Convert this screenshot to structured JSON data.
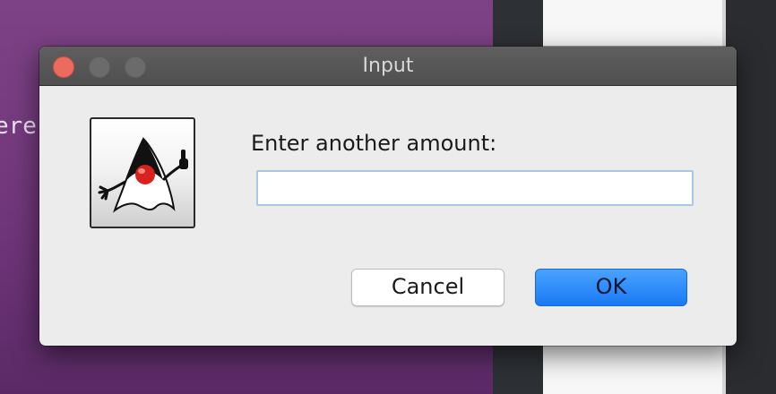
{
  "background": {
    "terminal_fragment": "ere",
    "colors": {
      "desktop": "#7a3f82",
      "dark_panel": "#2d3034",
      "light_panel": "#f7f7f7"
    }
  },
  "dialog": {
    "title": "Input",
    "icon": "java-duke-icon",
    "prompt": "Enter another amount:",
    "input": {
      "value": "",
      "placeholder": ""
    },
    "buttons": {
      "cancel": "Cancel",
      "ok": "OK"
    },
    "colors": {
      "ok_button": "#1a79f5",
      "close_button": "#ed6a5e",
      "input_focus": "#a9c7e8"
    }
  }
}
